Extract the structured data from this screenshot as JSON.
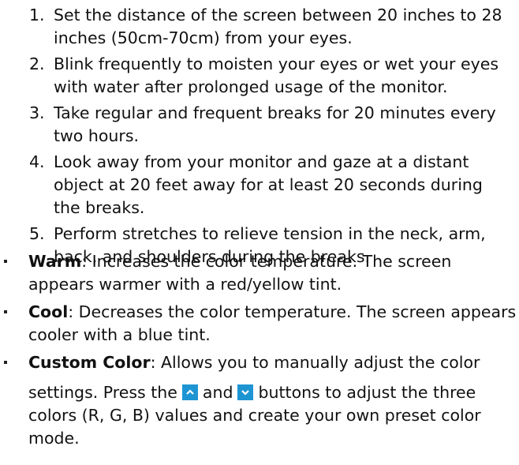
{
  "steps": [
    {
      "number": "1.",
      "text": "Set the distance of the screen between 20 inches to 28 inches (50cm-70cm) from your eyes."
    },
    {
      "number": "2.",
      "text": "Blink frequently to moisten your eyes or wet your eyes with water after prolonged usage of the monitor."
    },
    {
      "number": "3.",
      "text": "Take regular and frequent breaks for 20 minutes every two hours."
    },
    {
      "number": "4.",
      "text": "Look away from your monitor and gaze at a distant object at 20 feet away for at least 20 seconds during the breaks."
    },
    {
      "number": "5.",
      "text": "Perform stretches to relieve tension in the neck, arm, back, and shoulders during the breaks."
    }
  ],
  "modes": {
    "warm": {
      "term": "Warm",
      "desc": ": Increases the color temperature. The screen appears warmer with a red/yellow tint."
    },
    "cool": {
      "term": "Cool",
      "desc": ": Decreases the color temperature. The screen appears cooler with a blue tint."
    },
    "custom": {
      "term": "Custom Color",
      "desc_line1": ": Allows you to manually adjust the color",
      "desc_pre": "settings. Press the",
      "desc_mid": "and",
      "desc_post": "buttons to adjust the three colors (R, G, B) values and create your own preset color mode."
    }
  },
  "icons": {
    "up": "chevron-up-icon",
    "down": "chevron-down-icon"
  },
  "colors": {
    "button_bg": "#1e95d3",
    "text": "#111111"
  }
}
